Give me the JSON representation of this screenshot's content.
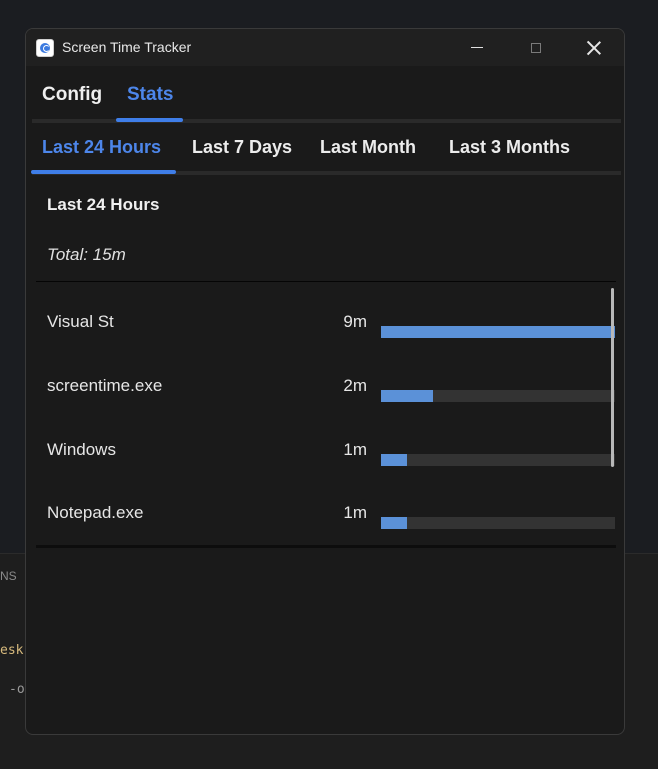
{
  "background": {
    "panel_label": "NS",
    "code_line_1": "esk",
    "code_line_2": "-o"
  },
  "window": {
    "title": "Screen Time Tracker"
  },
  "tabs": [
    {
      "label": "Config"
    },
    {
      "label": "Stats"
    }
  ],
  "periods": [
    {
      "label": "Last 24 Hours"
    },
    {
      "label": "Last 7 Days"
    },
    {
      "label": "Last Month"
    },
    {
      "label": "Last 3 Months"
    }
  ],
  "stats": {
    "heading": "Last 24 Hours",
    "total": "Total: 15m",
    "rows": [
      {
        "name": "Visual St",
        "time": "9m",
        "fraction": 1.0
      },
      {
        "name": "screentime.exe",
        "time": "2m",
        "fraction": 0.222
      },
      {
        "name": "Windows",
        "time": "1m",
        "fraction": 0.111
      },
      {
        "name": "Notepad.exe",
        "time": "1m",
        "fraction": 0.111
      }
    ]
  },
  "colors": {
    "accent": "#4d86ea",
    "bar_fill": "#5b91d8",
    "bar_track": "#333333"
  },
  "icons": {
    "app": "screen-time-app-icon"
  }
}
